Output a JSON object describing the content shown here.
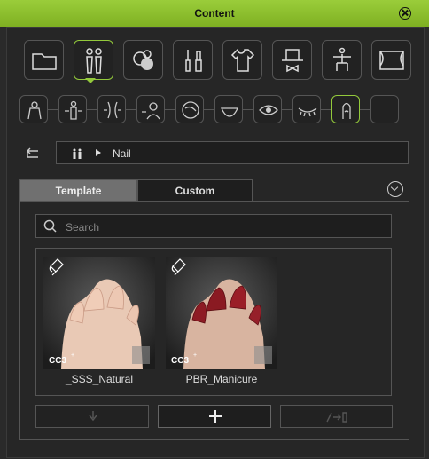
{
  "window": {
    "title": "Content"
  },
  "path": {
    "text": "Nail"
  },
  "tabs": {
    "template": "Template",
    "custom": "Custom"
  },
  "search": {
    "placeholder": "Search"
  },
  "items": [
    {
      "label": "_SSS_Natural",
      "badge": "CC3+"
    },
    {
      "label": "PBR_Manicure",
      "badge": "CC3+"
    }
  ],
  "colors": {
    "accent": "#93c93b"
  }
}
